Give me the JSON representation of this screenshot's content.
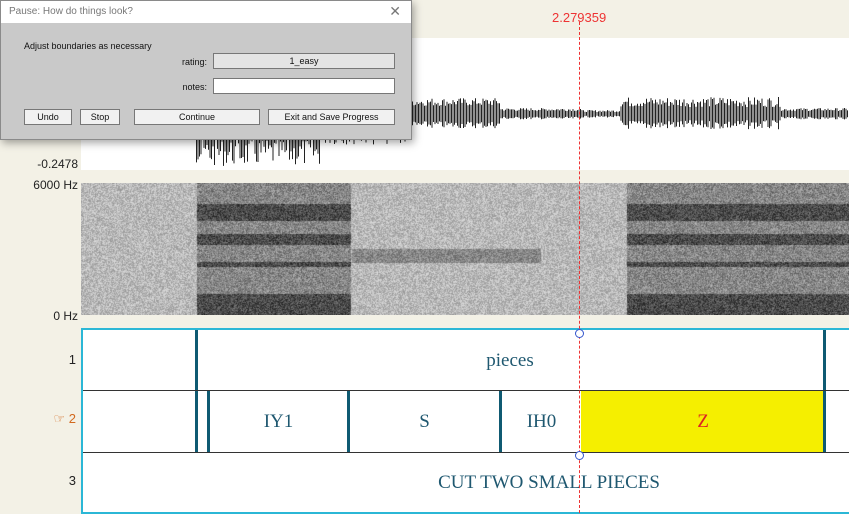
{
  "cursor": {
    "time": "2.279359"
  },
  "wave": {
    "ymin": "-0.2478"
  },
  "spectrogram": {
    "fmax": "6000 Hz",
    "fmin": "0 Hz"
  },
  "tiers": [
    {
      "number": "1",
      "active": false,
      "intervals": [
        "pieces"
      ]
    },
    {
      "number": "2",
      "active": true,
      "pointer_icon": "☞",
      "intervals": [
        "IY1",
        "S",
        "IH0",
        "Z"
      ]
    },
    {
      "number": "3",
      "active": false,
      "intervals": [
        "CUT TWO SMALL PIECES"
      ]
    }
  ],
  "dialog": {
    "title": "Pause: How do things look?",
    "instruction": "Adjust boundaries as necessary",
    "rating_label": "rating:",
    "rating_value": "1_easy",
    "notes_label": "notes:",
    "notes_value": "",
    "buttons": {
      "undo": "Undo",
      "stop": "Stop",
      "continue": "Continue",
      "exit": "Exit and Save Progress"
    }
  },
  "colors": {
    "cursor": "#e33333",
    "highlight": "#f5ef00",
    "tier_border": "#2bb7d6",
    "boundary": "#0f5a72"
  }
}
